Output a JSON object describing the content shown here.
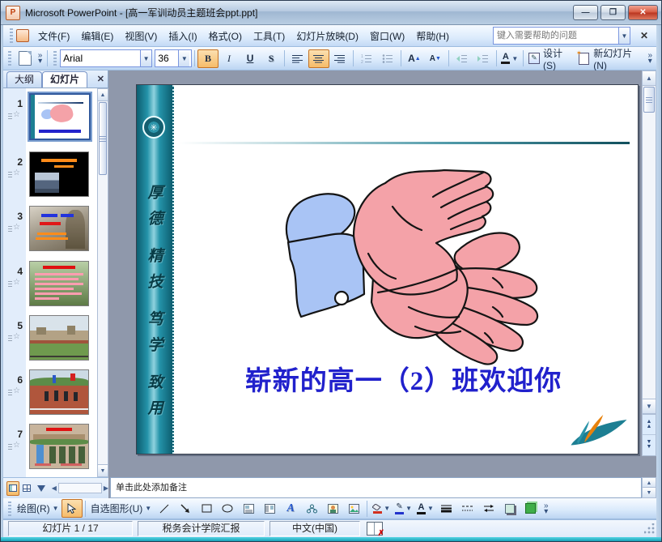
{
  "window": {
    "title": "Microsoft PowerPoint - [高一军训动员主题班会ppt.ppt]"
  },
  "menu": {
    "items": [
      "文件(F)",
      "编辑(E)",
      "视图(V)",
      "插入(I)",
      "格式(O)",
      "工具(T)",
      "幻灯片放映(D)",
      "窗口(W)",
      "帮助(H)"
    ],
    "help_placeholder": "键入需要帮助的问题"
  },
  "toolbar": {
    "font_name": "Arial",
    "font_size": "36",
    "bold": "B",
    "italic": "I",
    "underline": "U",
    "shadow": "S",
    "design_label": "设计(S)",
    "new_slide_label": "新幻灯片(N)"
  },
  "left_pane": {
    "tab_outline": "大纲",
    "tab_slides": "幻灯片",
    "slide_numbers": [
      "1",
      "2",
      "3",
      "4",
      "5",
      "6",
      "7"
    ]
  },
  "slide": {
    "title": "崭新的高一（2）班欢迎你",
    "banner_chars": [
      "厚",
      "德",
      "精",
      "技",
      "笃",
      "学",
      "致",
      "用"
    ]
  },
  "notes": {
    "placeholder": "单击此处添加备注"
  },
  "drawing": {
    "draw_label": "绘图(R)",
    "autoshapes_label": "自选图形(U)"
  },
  "status": {
    "slide_info": "幻灯片 1 / 17",
    "document_title": "税务会计学院汇报",
    "language": "中文(中国)"
  },
  "colors": {
    "slide_title_blue": "#2121cc",
    "banner_teal": "#19758a",
    "pressed_orange": "#f6bc6a",
    "thumb_text_orange": "#ff8c1a"
  }
}
